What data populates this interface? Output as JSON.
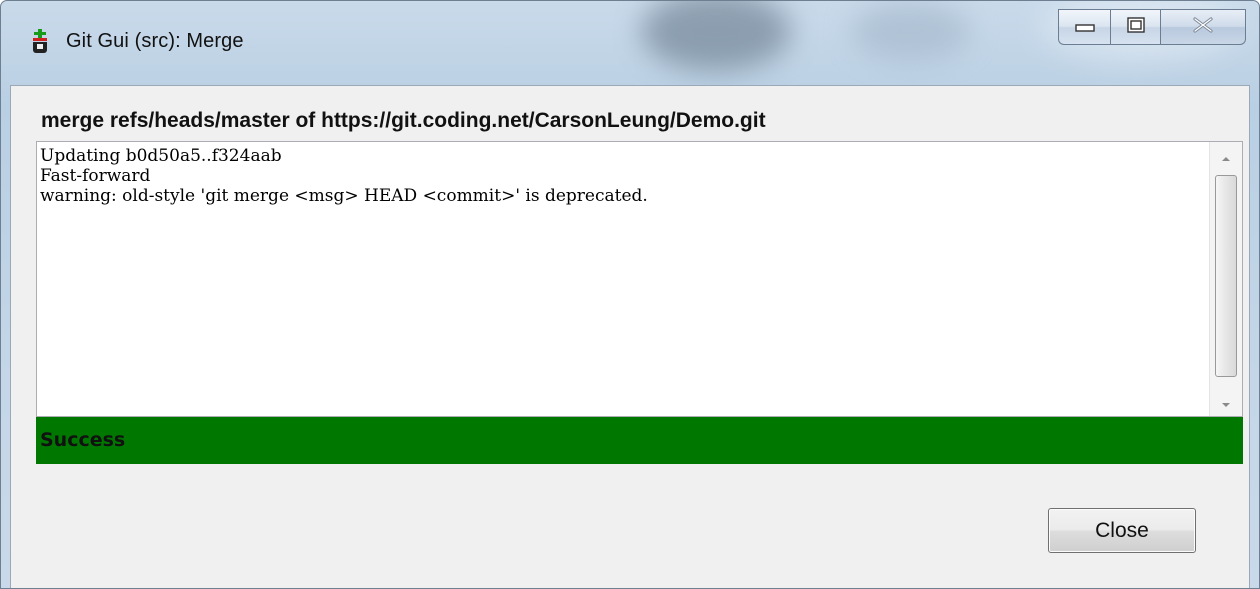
{
  "window": {
    "title": "Git Gui (src): Merge",
    "icon": "git-gui-app-icon",
    "controls": {
      "minimize_icon": "minimize-icon",
      "maximize_icon": "maximize-icon",
      "close_icon": "close-x-icon"
    }
  },
  "merge": {
    "heading": "merge refs/heads/master of https://git.coding.net/CarsonLeung/Demo.git",
    "output_lines": [
      "Updating b0d50a5..f324aab",
      "Fast-forward",
      "warning: old-style 'git merge <msg> HEAD <commit>' is deprecated."
    ]
  },
  "status": {
    "text": "Success",
    "color": "#007800"
  },
  "actions": {
    "close_label": "Close"
  }
}
